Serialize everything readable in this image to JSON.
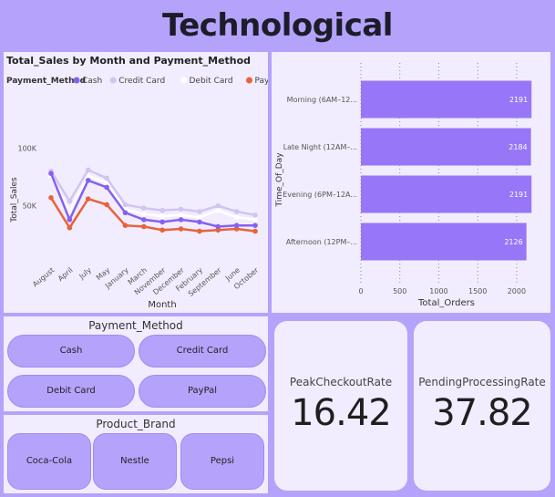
{
  "header": {
    "title": "Technological"
  },
  "line_chart": {
    "title": "Total_Sales by Month and Payment_Method",
    "legend_title": "Payment_Method",
    "y_ticks": [
      "100K",
      "50K"
    ],
    "colors": {
      "Cash": "#8660f1",
      "Credit Card": "#cfc5f0",
      "Debit Card": "#ffffff",
      "PayPal": "#e8623a"
    }
  },
  "bar_chart": {
    "y_axis_title": "Time_Of_Day",
    "x_axis_title": "Total_Orders",
    "x_ticks": [
      "0",
      "500",
      "1000",
      "1500",
      "2000"
    ],
    "bar_color": "#9776f7"
  },
  "payment_slicer": {
    "title": "Payment_Method",
    "options": [
      "Cash",
      "Credit Card",
      "Debit Card",
      "PayPal"
    ]
  },
  "brand_slicer": {
    "title": "Product_Brand",
    "options": [
      "Coca-Cola",
      "Nestle",
      "Pepsi"
    ]
  },
  "cards": [
    {
      "label": "PeakCheckoutRate",
      "value": "16.42"
    },
    {
      "label": "PendingProcessingRate",
      "value": "37.82"
    }
  ],
  "chart_data": [
    {
      "type": "line",
      "title": "Total_Sales by Month and Payment_Method",
      "xlabel": "Month",
      "ylabel": "Total_Sales",
      "categories": [
        "August",
        "April",
        "July",
        "May",
        "January",
        "March",
        "November",
        "December",
        "February",
        "September",
        "June",
        "October"
      ],
      "ylim": [
        0,
        120000
      ],
      "legend": "top-left",
      "series": [
        {
          "name": "Cash",
          "values": [
            78000,
            38000,
            72000,
            66000,
            44000,
            38000,
            36000,
            38000,
            36000,
            32000,
            33000,
            33000
          ]
        },
        {
          "name": "Credit Card",
          "values": [
            80000,
            54000,
            81000,
            74000,
            51000,
            48000,
            46000,
            47000,
            45000,
            50000,
            45000,
            42000
          ]
        },
        {
          "name": "Debit Card",
          "values": [
            76000,
            45000,
            76000,
            70000,
            47000,
            43000,
            41000,
            42000,
            40000,
            46000,
            40000,
            38000
          ]
        },
        {
          "name": "PayPal",
          "values": [
            57000,
            31000,
            56000,
            51000,
            33000,
            32000,
            29000,
            30000,
            28000,
            29000,
            30000,
            28000
          ]
        }
      ]
    },
    {
      "type": "bar",
      "orientation": "horizontal",
      "xlabel": "Total_Orders",
      "ylabel": "Time_Of_Day",
      "categories": [
        "Morning (6AM–12...",
        "Late Night (12AM–...",
        "Evening (6PM–12A...",
        "Afternoon (12PM–..."
      ],
      "values": [
        2191,
        2184,
        2191,
        2126
      ],
      "xlim": [
        0,
        2200
      ]
    }
  ]
}
